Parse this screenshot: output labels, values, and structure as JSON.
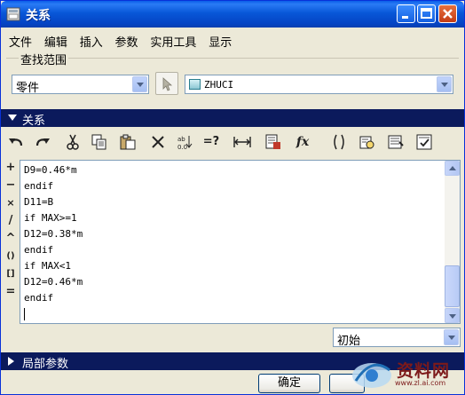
{
  "window": {
    "title": "关系",
    "controls": {
      "minimize": "_",
      "maximize": "□",
      "close": "✕"
    }
  },
  "menu": [
    "文件",
    "编辑",
    "插入",
    "参数",
    "实用工具",
    "显示"
  ],
  "search_range": {
    "label": "查找范围",
    "type_select": "零件",
    "model_select": "ZHUCI"
  },
  "relations_section": {
    "label": "关系"
  },
  "toolbar_icons": [
    "undo-icon",
    "redo-icon",
    "cut-icon",
    "copy-icon",
    "paste-icon",
    "delete-icon",
    "sort-icon",
    "evaluate-icon",
    "measure-icon",
    "parameters-icon",
    "function-icon",
    "brackets-icon",
    "verify-icon",
    "display-icon",
    "checklist-icon"
  ],
  "toolbar_text": {
    "evaluate": "=?",
    "function": "fx"
  },
  "operators": [
    "+",
    "−",
    "×",
    "/",
    "^",
    "()",
    "[]",
    "="
  ],
  "relations": [
    "D9=0.46*m",
    "endif",
    "D11=B",
    "if MAX>=1",
    "D12=0.38*m",
    "endif",
    "if MAX<1",
    "D12=0.46*m",
    "endif"
  ],
  "units_select": "初始",
  "local_params_section": {
    "label": "局部参数"
  },
  "buttons": {
    "ok": "确定"
  },
  "watermark": {
    "brand": "资料网",
    "url": "www.zl.ai.com"
  },
  "colors": {
    "titlebar": "#0857d8",
    "section_bar": "#0b1a5c",
    "border_blue": "#7f9db9"
  }
}
